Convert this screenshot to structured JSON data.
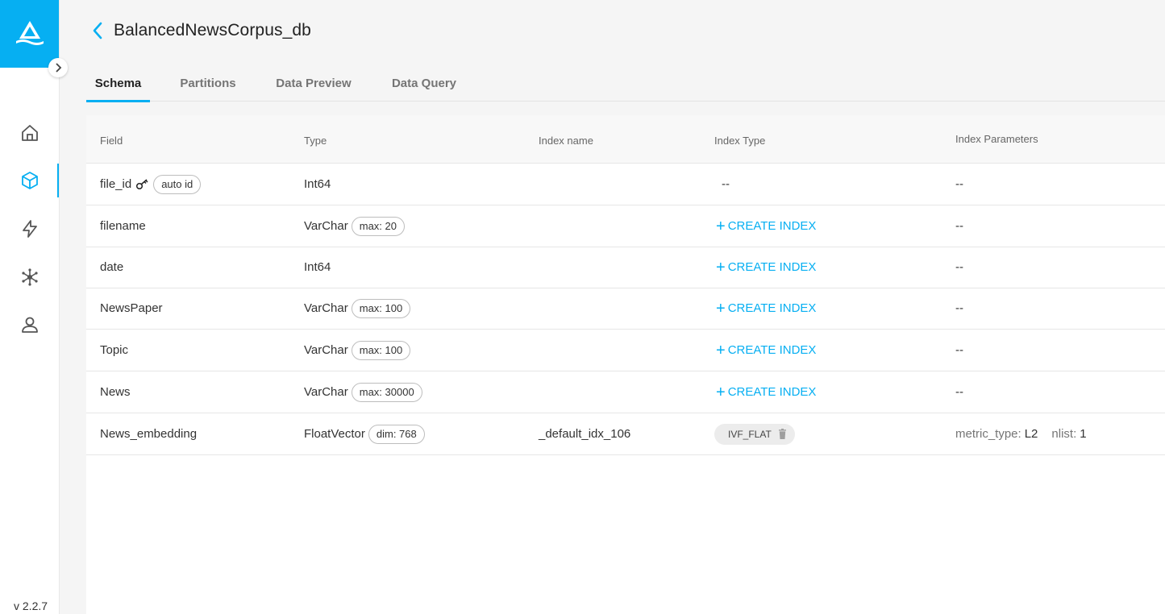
{
  "app": {
    "version": "v 2.2.7"
  },
  "header": {
    "title": "BalancedNewsCorpus_db"
  },
  "tabs": [
    {
      "label": "Schema",
      "active": true
    },
    {
      "label": "Partitions",
      "active": false
    },
    {
      "label": "Data Preview",
      "active": false
    },
    {
      "label": "Data Query",
      "active": false
    }
  ],
  "nav": {
    "items": [
      "home-icon",
      "collection-icon",
      "lightning-icon",
      "network-icon",
      "user-icon"
    ],
    "active": "collection-icon"
  },
  "table": {
    "headers": {
      "field": "Field",
      "type": "Type",
      "index_name": "Index name",
      "index_type": "Index Type",
      "index_params": "Index Parameters"
    },
    "rows": [
      {
        "field": "file_id",
        "badge": "auto id",
        "type": "Int64",
        "type_chip": "",
        "index_name": "",
        "index_type": "--",
        "index_params": "--"
      },
      {
        "field": "filename",
        "type": "VarChar",
        "type_chip": "max: 20",
        "index_name": "",
        "index_action": "CREATE INDEX",
        "index_params": "--"
      },
      {
        "field": "date",
        "type": "Int64",
        "type_chip": "",
        "index_name": "",
        "index_action": "CREATE INDEX",
        "index_params": "--"
      },
      {
        "field": "NewsPaper",
        "type": "VarChar",
        "type_chip": "max: 100",
        "index_name": "",
        "index_action": "CREATE INDEX",
        "index_params": "--"
      },
      {
        "field": "Topic",
        "type": "VarChar",
        "type_chip": "max: 100",
        "index_name": "",
        "index_action": "CREATE INDEX",
        "index_params": "--"
      },
      {
        "field": "News",
        "type": "VarChar",
        "type_chip": "max: 30000",
        "index_name": "",
        "index_action": "CREATE INDEX",
        "index_params": "--"
      },
      {
        "field": "News_embedding",
        "type": "FloatVector",
        "type_chip": "dim: 768",
        "index_name": "_default_idx_106",
        "index_type_chip": "IVF_FLAT",
        "params": {
          "metric_label": "metric_type:",
          "metric_value": "L2",
          "nlist_label": "nlist:",
          "nlist_value": "1"
        }
      }
    ]
  },
  "colors": {
    "accent": "#06aff2"
  }
}
